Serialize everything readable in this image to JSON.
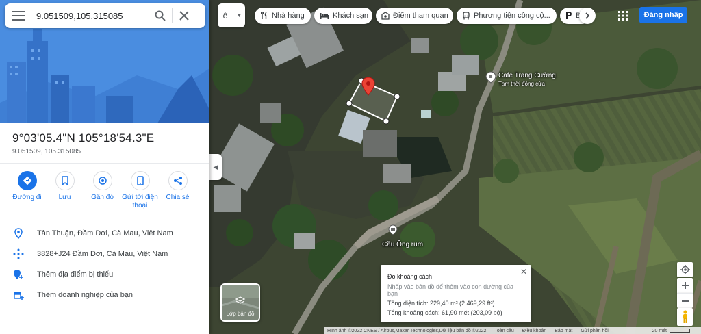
{
  "search": {
    "value": "9.051509,105.315085"
  },
  "place": {
    "dms": "9°03'05.4\"N 105°18'54.3\"E",
    "decimal": "9.051509, 105.315085"
  },
  "actions": [
    {
      "label": "Đường đi",
      "icon": "directions-icon"
    },
    {
      "label": "Lưu",
      "icon": "bookmark-icon"
    },
    {
      "label": "Gần đó",
      "icon": "nearby-icon"
    },
    {
      "label": "Gửi tới điện thoại",
      "icon": "phone-icon"
    },
    {
      "label": "Chia sẻ",
      "icon": "share-icon"
    }
  ],
  "info": [
    {
      "text": "Tân Thuận, Đầm Dơi, Cà Mau, Việt Nam",
      "icon": "location-pin-icon"
    },
    {
      "text": "3828+J24 Đầm Dơi, Cà Mau, Việt Nam",
      "icon": "plus-code-icon"
    },
    {
      "text": "Thêm địa điểm bị thiếu",
      "icon": "add-place-icon"
    },
    {
      "text": "Thêm doanh nghiệp của bạn",
      "icon": "add-business-icon"
    }
  ],
  "layer_select": {
    "value": "ê"
  },
  "chips": [
    {
      "label": "Nhà hàng",
      "icon": "restaurant-icon"
    },
    {
      "label": "Khách sạn",
      "icon": "hotel-icon"
    },
    {
      "label": "Điểm tham quan",
      "icon": "attraction-icon"
    },
    {
      "label": "Phương tiện công cộ...",
      "icon": "transit-icon"
    },
    {
      "label": "B",
      "icon": "parking-icon"
    }
  ],
  "header": {
    "login_label": "Đăng nhập"
  },
  "map": {
    "poi_cafe": "Cafe Trang Cường",
    "poi_cafe_status": "Tạm thời đóng cửa",
    "poi_bridge": "Cầu Ông rum"
  },
  "measure": {
    "title": "Đo khoảng cách",
    "hint": "Nhấp vào bản đồ để thêm vào con đường của bạn",
    "area": "Tổng diện tích: 229,40 m² (2.469,29 ft²)",
    "distance": "Tổng khoảng cách: 61,90 mét (203,09 bộ)"
  },
  "layers_label": "Lớp bản đồ",
  "footer": {
    "attribution": "Hình ảnh ©2022 CNES / Airbus,Maxar Technologies,Dữ liệu bản đồ ©2022",
    "privacy": "Toàn cầu",
    "terms": "Điều khoản",
    "privacy2": "Bảo mật",
    "feedback": "Gửi phản hồi",
    "scale": "20 mét"
  },
  "colors": {
    "accent": "#1a73e8",
    "pin": "#ea4335",
    "hero_bg": "#4a8de0"
  }
}
